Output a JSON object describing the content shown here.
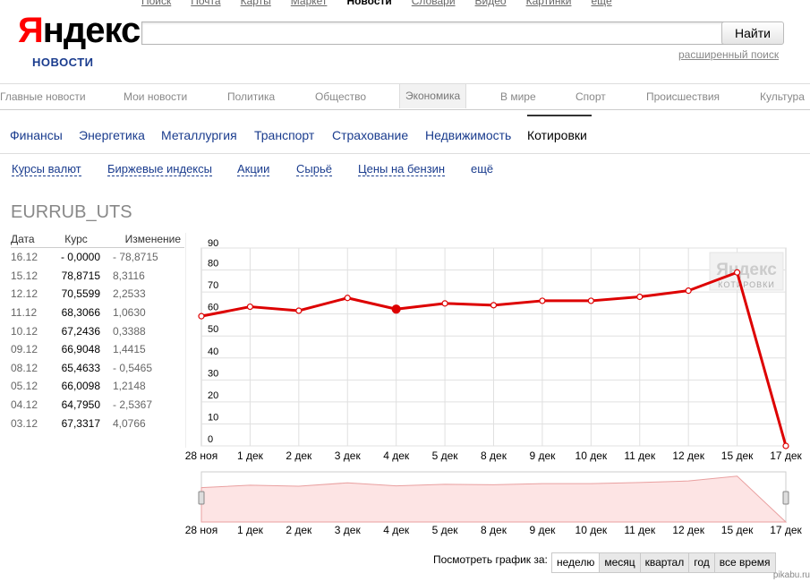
{
  "top_nav": [
    "Поиск",
    "Почта",
    "Карты",
    "Маркет",
    "Новости",
    "Словари",
    "Видео",
    "Картинки",
    "ещё"
  ],
  "top_nav_current": "Новости",
  "logo": {
    "first": "Я",
    "rest": "ндекс",
    "sub": "НОВОСТИ"
  },
  "search": {
    "value": "",
    "button": "Найти",
    "advanced": "расширенный поиск"
  },
  "sections": [
    "Главные новости",
    "Мои новости",
    "Политика",
    "Общество",
    "Экономика",
    "В мире",
    "Спорт",
    "Происшествия",
    "Культура"
  ],
  "sections_active": "Экономика",
  "subsections": [
    "Финансы",
    "Энергетика",
    "Металлургия",
    "Транспорт",
    "Страхование",
    "Недвижимость",
    "Котировки"
  ],
  "subsections_active": "Котировки",
  "tertiary": [
    "Курсы валют",
    "Биржевые индексы",
    "Акции",
    "Сырьё",
    "Цены на бензин",
    "ещё"
  ],
  "ticker": "EURRUB_UTS",
  "table": {
    "headers": [
      "Дата",
      "Курс",
      "Изменение"
    ],
    "rows": [
      [
        "16.12",
        "- 0,0000",
        "- 78,8715"
      ],
      [
        "15.12",
        "78,8715",
        "8,3116"
      ],
      [
        "12.12",
        "70,5599",
        "2,2533"
      ],
      [
        "11.12",
        "68,3066",
        "1,0630"
      ],
      [
        "10.12",
        "67,2436",
        "0,3388"
      ],
      [
        "09.12",
        "66,9048",
        "1,4415"
      ],
      [
        "08.12",
        "65,4633",
        "- 0,5465"
      ],
      [
        "05.12",
        "66,0098",
        "1,2148"
      ],
      [
        "04.12",
        "64,7950",
        "- 2,5367"
      ],
      [
        "03.12",
        "67,3317",
        "4,0766"
      ]
    ]
  },
  "chart_data": {
    "type": "line",
    "x": [
      "28 ноя",
      "1 дек",
      "2 дек",
      "3 дек",
      "4 дек",
      "5 дек",
      "8 дек",
      "9 дек",
      "10 дек",
      "11 дек",
      "12 дек",
      "15 дек",
      "17 дек"
    ],
    "series": [
      {
        "values": [
          59,
          63.3,
          61.5,
          67.3,
          62.2,
          64.8,
          64.0,
          66.0,
          66.0,
          67.8,
          70.6,
          78.9,
          0
        ]
      }
    ],
    "highlight_index": 4,
    "ylim": [
      0,
      90
    ],
    "yticks": [
      0,
      10,
      20,
      30,
      40,
      50,
      60,
      70,
      80,
      90
    ],
    "grid": true,
    "line_color": "#dd0000",
    "overview_fill": "#fde4e4",
    "watermark": {
      "line1": "Яндекс",
      "line2": "КОТИРОВКИ"
    }
  },
  "view_bar": {
    "label": "Посмотреть график за:",
    "buttons": [
      "неделю",
      "месяц",
      "квартал",
      "год",
      "все время"
    ],
    "active": "неделю"
  },
  "watermark_site": "pikabu.ru"
}
